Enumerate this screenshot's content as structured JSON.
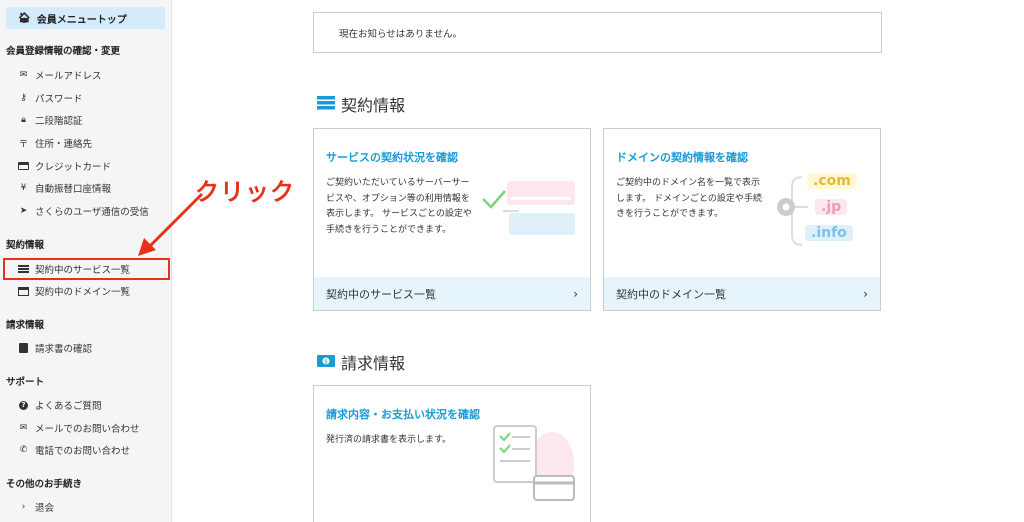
{
  "sidebar": {
    "top_item": "会員メニュートップ",
    "sections": [
      {
        "title": "会員登録情報の確認・変更",
        "items": [
          "メールアドレス",
          "パスワード",
          "二段階認証",
          "住所・連絡先",
          "クレジットカード",
          "自動振替口座情報",
          "さくらのユーザ通信の受信"
        ]
      },
      {
        "title": "契約情報",
        "items": [
          "契約中のサービス一覧",
          "契約中のドメイン一覧"
        ]
      },
      {
        "title": "請求情報",
        "items": [
          "請求書の確認"
        ]
      },
      {
        "title": "サポート",
        "items": [
          "よくあるご質問",
          "メールでのお問い合わせ",
          "電話でのお問い合わせ"
        ]
      },
      {
        "title": "その他のお手続き",
        "items": [
          "退会"
        ]
      }
    ]
  },
  "annotation": {
    "text": "クリック",
    "color": "#e8311a"
  },
  "notice": {
    "text": "現在お知らせはありません。"
  },
  "contract": {
    "heading": "契約情報",
    "service_card": {
      "title": "サービスの契約状況を確認",
      "desc": "ご契約いただいているサーバーサービスや、オプション等の利用情報を表示します。 サービスごとの設定や手続きを行うことができます。",
      "footer": "契約中のサービス一覧"
    },
    "domain_card": {
      "title": "ドメインの契約情報を確認",
      "desc": "ご契約中のドメイン名を一覧で表示します。 ドメインごとの設定や手続きを行うことができます。",
      "footer": "契約中のドメイン一覧",
      "tlds": [
        ".com",
        ".jp",
        ".info"
      ]
    }
  },
  "billing": {
    "heading": "請求情報",
    "card": {
      "title": "請求内容・お支払い状況を確認",
      "desc": "発行済の請求書を表示します。"
    }
  },
  "colors": {
    "accent": "#1a9ad6",
    "highlight": "#e8311a",
    "sidebar_active": "#d4ecf9"
  }
}
